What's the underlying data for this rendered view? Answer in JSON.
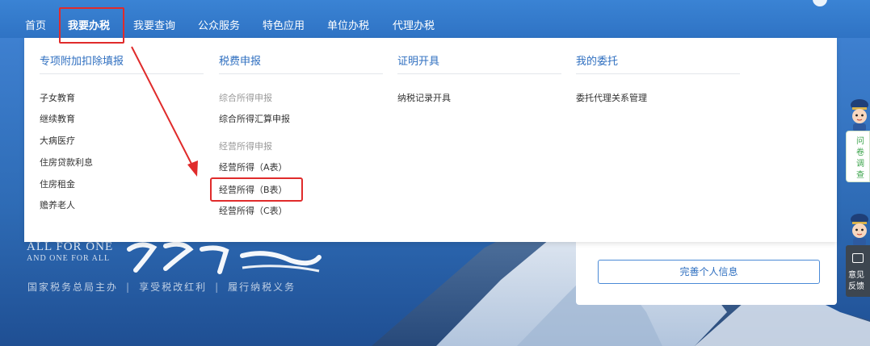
{
  "nav": {
    "items": [
      {
        "label": "首页",
        "active": false
      },
      {
        "label": "我要办税",
        "active": true
      },
      {
        "label": "我要查询",
        "active": false
      },
      {
        "label": "公众服务",
        "active": false
      },
      {
        "label": "特色应用",
        "active": false
      },
      {
        "label": "单位办税",
        "active": false
      },
      {
        "label": "代理办税",
        "active": false
      }
    ]
  },
  "menu": {
    "columns": [
      {
        "heading": "专项附加扣除填报",
        "items": [
          "子女教育",
          "继续教育",
          "大病医疗",
          "住房贷款利息",
          "住房租金",
          "赡养老人"
        ]
      },
      {
        "heading": "税费申报",
        "group1_label": "综合所得申报",
        "group1_items": [
          "综合所得汇算申报"
        ],
        "group2_label": "经营所得申报",
        "group2_items": [
          "经营所得（A表）",
          "经营所得（B表）",
          "经营所得（C表）"
        ]
      },
      {
        "heading": "证明开具",
        "items": [
          "纳税记录开具"
        ]
      },
      {
        "heading": "我的委托",
        "items": [
          "委托代理关系管理"
        ]
      }
    ]
  },
  "hero": {
    "slogan_en_line1": "ALL FOR ONE",
    "slogan_en_line2": "AND ONE FOR ALL",
    "slogan_cn": [
      "国家税务总局主办",
      "享受税改红利",
      "履行纳税义务"
    ]
  },
  "profile": {
    "button_label": "完善个人信息"
  },
  "floating": {
    "survey_label": [
      "问",
      "卷",
      "调",
      "查"
    ],
    "feedback_label": [
      "意见",
      "反馈"
    ]
  },
  "colors": {
    "brand_blue": "#2f73c4",
    "annotation_red": "#e02b2b",
    "link_blue": "#2f6fc0",
    "survey_green": "#3aa34a"
  }
}
